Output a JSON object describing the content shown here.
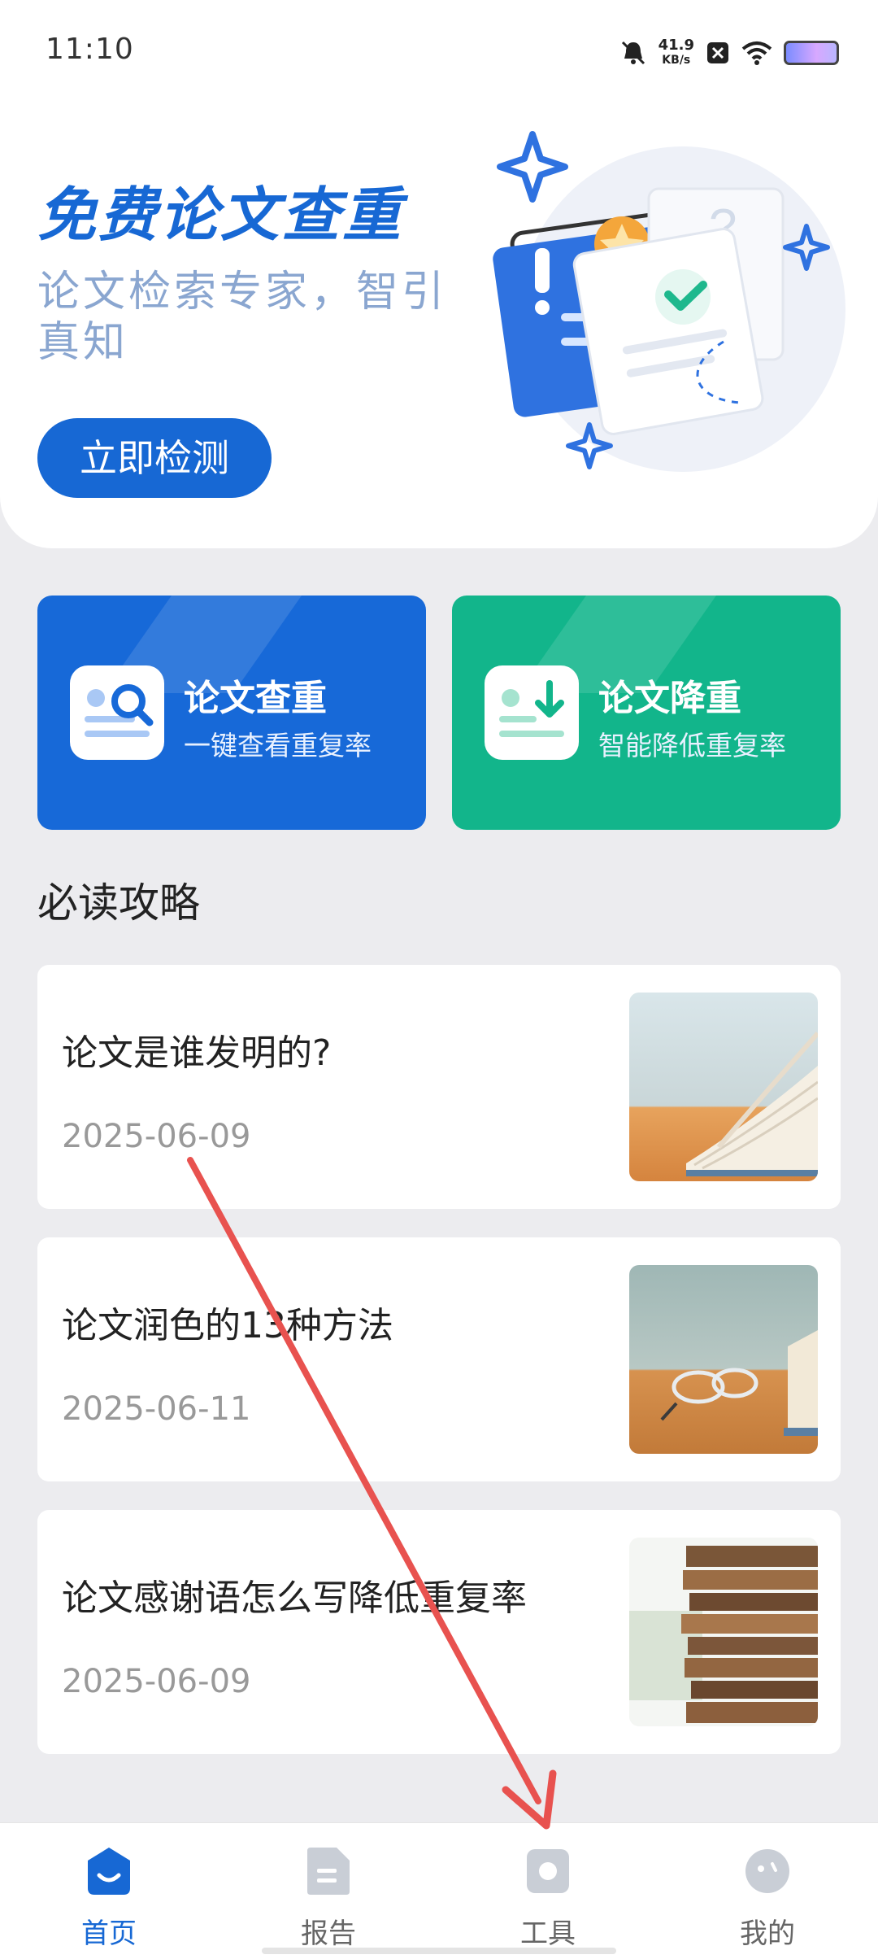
{
  "status_bar": {
    "time": "11:10",
    "speed_value": "41.9",
    "speed_unit": "KB/s"
  },
  "hero": {
    "title": "免费论文查重",
    "subtitle": "论文检索专家，智引真知",
    "cta": "立即检测"
  },
  "features": [
    {
      "title": "论文查重",
      "subtitle": "一键查看重复率",
      "icon": "search-document-icon"
    },
    {
      "title": "论文降重",
      "subtitle": "智能降低重复率",
      "icon": "download-document-icon"
    }
  ],
  "section_title": "必读攻略",
  "articles": [
    {
      "title": "论文是谁发明的?",
      "date": "2025-06-09"
    },
    {
      "title": "论文润色的13种方法",
      "date": "2025-06-11"
    },
    {
      "title": "论文感谢语怎么写降低重复率",
      "date": "2025-06-09"
    }
  ],
  "tabs": [
    {
      "label": "首页",
      "icon": "home-icon",
      "active": true
    },
    {
      "label": "报告",
      "icon": "report-icon",
      "active": false
    },
    {
      "label": "工具",
      "icon": "tools-icon",
      "active": false
    },
    {
      "label": "我的",
      "icon": "profile-icon",
      "active": false
    }
  ],
  "colors": {
    "primary": "#1768d4",
    "green": "#12b58b",
    "annotation": "#e8524f"
  }
}
